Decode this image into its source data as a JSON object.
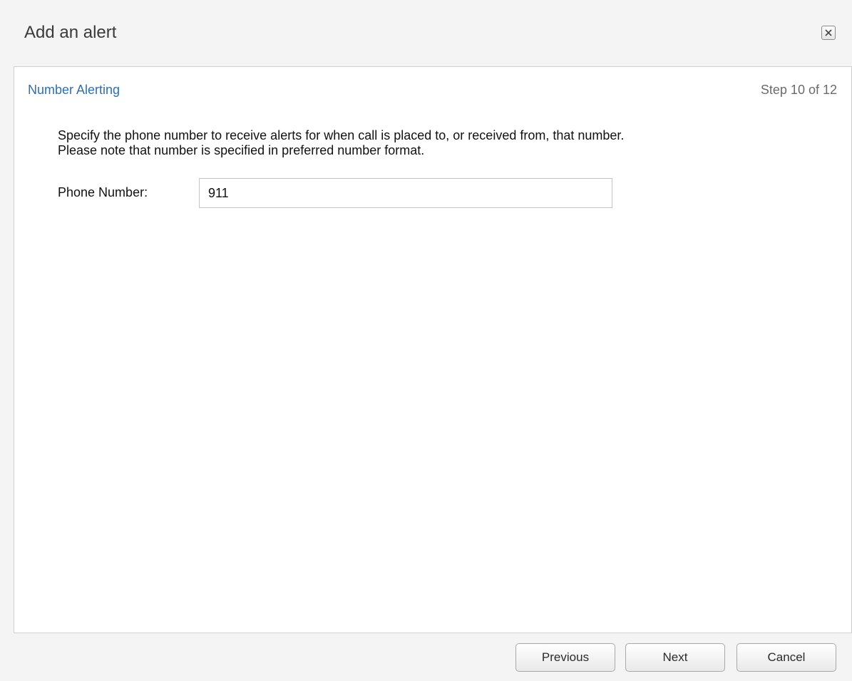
{
  "dialog": {
    "title": "Add an alert",
    "close_icon": "close-icon"
  },
  "section": {
    "title": "Number Alerting",
    "step": "Step 10 of 12"
  },
  "description": {
    "line1": "Specify the phone number to receive alerts for when call is placed to, or received from, that number.",
    "line2": "Please note that number is specified in preferred number format."
  },
  "form": {
    "phone_label": "Phone Number:",
    "phone_value": "911"
  },
  "footer": {
    "previous_label": "Previous",
    "next_label": "Next",
    "cancel_label": "Cancel"
  },
  "colors": {
    "section_title": "#2d6fb0",
    "background": "#f4f4f4",
    "panel": "#ffffff"
  }
}
